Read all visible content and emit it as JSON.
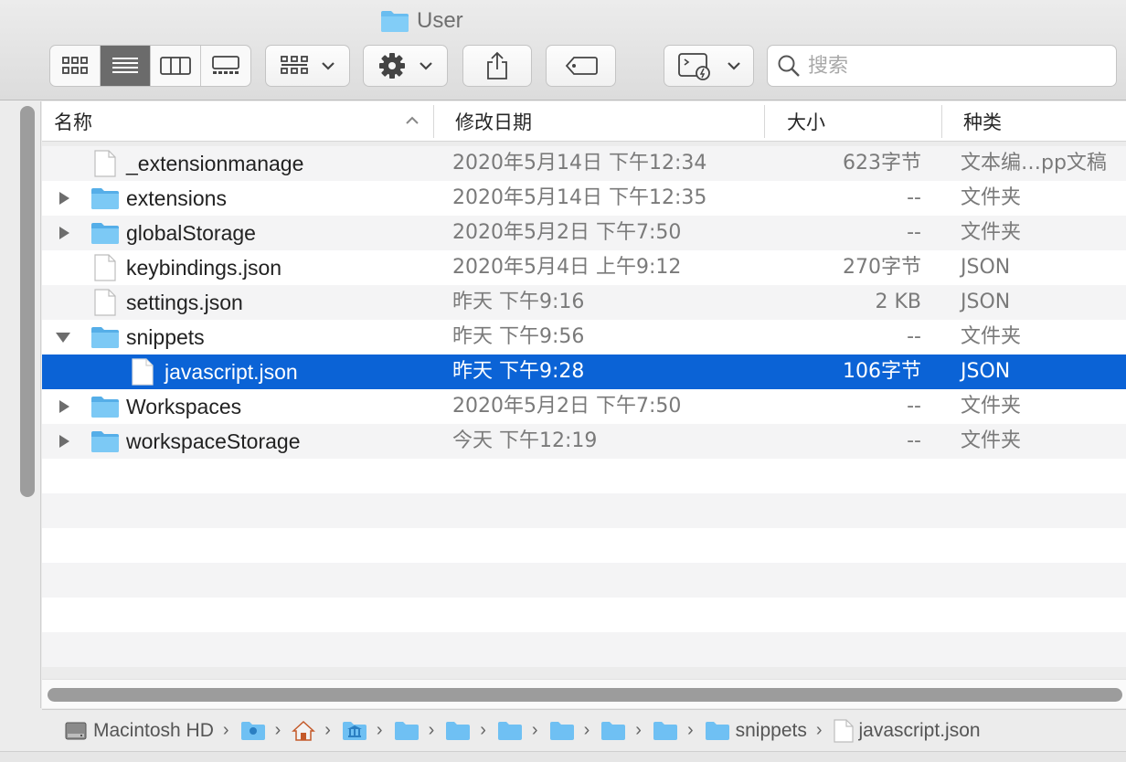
{
  "window": {
    "title": "User"
  },
  "toolbar": {
    "view_modes": [
      {
        "icon": "icon-view-icon"
      },
      {
        "icon": "list-view-icon",
        "active": true
      },
      {
        "icon": "column-view-icon"
      },
      {
        "icon": "gallery-view-icon"
      }
    ],
    "group_icon": "group-by-icon",
    "action_icon": "gear-icon",
    "share_icon": "share-icon",
    "tag_icon": "tag-icon",
    "quick_action_icon": "quick-actions-icon",
    "search_placeholder": "搜索"
  },
  "columns": {
    "name": "名称",
    "date": "修改日期",
    "size": "大小",
    "kind": "种类"
  },
  "rows": [
    {
      "name": "_extensionmanage",
      "date": "2020年5月14日 下午12:34",
      "size": "623字节",
      "kind": "文本编…pp文稿",
      "type": "file",
      "disclosure": "none",
      "level": 0
    },
    {
      "name": "extensions",
      "date": "2020年5月14日 下午12:35",
      "size": "--",
      "kind": "文件夹",
      "type": "folder",
      "disclosure": "collapsed",
      "level": 0
    },
    {
      "name": "globalStorage",
      "date": "2020年5月2日 下午7:50",
      "size": "--",
      "kind": "文件夹",
      "type": "folder",
      "disclosure": "collapsed",
      "level": 0
    },
    {
      "name": "keybindings.json",
      "date": "2020年5月4日 上午9:12",
      "size": "270字节",
      "kind": "JSON",
      "type": "file",
      "disclosure": "none",
      "level": 0
    },
    {
      "name": "settings.json",
      "date": "昨天 下午9:16",
      "size": "2 KB",
      "kind": "JSON",
      "type": "file",
      "disclosure": "none",
      "level": 0
    },
    {
      "name": "snippets",
      "date": "昨天 下午9:56",
      "size": "--",
      "kind": "文件夹",
      "type": "folder",
      "disclosure": "expanded",
      "level": 0
    },
    {
      "name": "javascript.json",
      "date": "昨天 下午9:28",
      "size": "106字节",
      "kind": "JSON",
      "type": "file",
      "disclosure": "none",
      "level": 1,
      "selected": true
    },
    {
      "name": "Workspaces",
      "date": "2020年5月2日 下午7:50",
      "size": "--",
      "kind": "文件夹",
      "type": "folder",
      "disclosure": "collapsed",
      "level": 0
    },
    {
      "name": "workspaceStorage",
      "date": "今天 下午12:19",
      "size": "--",
      "kind": "文件夹",
      "type": "folder",
      "disclosure": "collapsed",
      "level": 0
    }
  ],
  "pathbar": {
    "disk": "Macintosh HD",
    "current_folder": "snippets",
    "current_file": "javascript.json"
  },
  "colors": {
    "selection": "#0b63d6",
    "folder": "#5fb4ec"
  }
}
